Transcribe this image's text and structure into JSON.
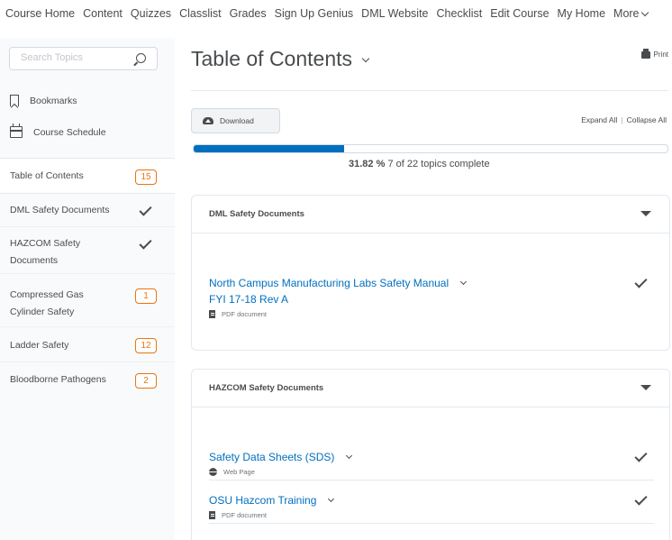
{
  "nav": {
    "items": [
      "Course Home",
      "Content",
      "Quizzes",
      "Classlist",
      "Grades",
      "Sign Up Genius",
      "DML Website",
      "Checklist",
      "Edit Course",
      "My Home"
    ],
    "more": "More"
  },
  "sidebar": {
    "search_placeholder": "Search Topics",
    "bookmarks": "Bookmarks",
    "schedule": "Course Schedule",
    "modules": [
      {
        "label": "Table of Contents",
        "badge": "15",
        "status": "badge",
        "active": true
      },
      {
        "label": "DML Safety Documents",
        "status": "complete"
      },
      {
        "label_line1": "HAZCOM Safety",
        "label_line2": "Documents",
        "status": "complete"
      },
      {
        "label_line1": "Compressed Gas",
        "label_line2": "Cylinder Safety",
        "badge": "1",
        "status": "badge"
      },
      {
        "label": "Ladder Safety",
        "badge": "12",
        "status": "badge"
      },
      {
        "label": "Bloodborne Pathogens",
        "badge": "2",
        "status": "badge"
      }
    ]
  },
  "main": {
    "title": "Table of Contents",
    "print": "Print",
    "download": "Download",
    "expand_all": "Expand All",
    "separator": "|",
    "collapse_all": "Collapse All",
    "progress": {
      "fraction": 0.3182,
      "percent_text": "31.82 %",
      "topics_text": "7 of 22 topics complete"
    },
    "sections": [
      {
        "title": "DML Safety Documents",
        "topics": [
          {
            "line1": "North Campus Manufacturing Labs Safety Manual",
            "line2": "FYI 17-18 Rev A",
            "type": "PDF document",
            "icon": "pdf-icon",
            "complete": true
          }
        ]
      },
      {
        "title": "HAZCOM Safety Documents",
        "topics": [
          {
            "line1": "Safety Data Sheets (SDS)",
            "type": "Web Page",
            "icon": "web-icon",
            "complete": true
          },
          {
            "line1": "OSU Hazcom Training",
            "type": "PDF document",
            "icon": "pdf-icon",
            "complete": true
          }
        ]
      }
    ]
  },
  "colors": {
    "accent": "#006fbf",
    "badge": "#e87511",
    "text": "#494c4e"
  }
}
